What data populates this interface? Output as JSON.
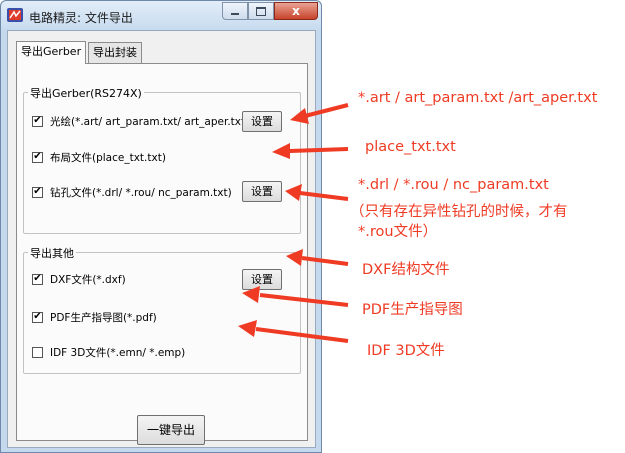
{
  "window": {
    "title": "电路精灵: 文件导出",
    "close_glyph": "x"
  },
  "tabs": [
    {
      "label": "导出Gerber",
      "active": true
    },
    {
      "label": "导出封装",
      "active": false
    }
  ],
  "gerber_group": {
    "title": "导出Gerber(RS274X)",
    "items": [
      {
        "label": "光绘(*.art/ art_param.txt/ art_aper.txt)",
        "checked": true,
        "has_settings": true
      },
      {
        "label": "布局文件(place_txt.txt)",
        "checked": true,
        "has_settings": false
      },
      {
        "label": "钻孔文件(*.drl/ *.rou/ nc_param.txt)",
        "checked": true,
        "has_settings": true
      }
    ]
  },
  "other_group": {
    "title": "导出其他",
    "items": [
      {
        "label": "DXF文件(*.dxf)",
        "checked": true,
        "has_settings": true
      },
      {
        "label": "PDF生产指导图(*.pdf)",
        "checked": true,
        "has_settings": false
      },
      {
        "label": "IDF 3D文件(*.emn/ *.emp)",
        "checked": false,
        "has_settings": false
      }
    ]
  },
  "settings_label": "设置",
  "check_mark": "✔",
  "export_button": "一键导出",
  "annotations": [
    "*.art / art_param.txt /art_aper.txt",
    "place_txt.txt",
    "*.drl / *.rou / nc_param.txt",
    "（只有存在异性钻孔的时候，才有",
    "*.rou文件）",
    "DXF结构文件",
    "PDF生产指导图",
    "IDF 3D文件"
  ],
  "colors": {
    "annotation": "#ef3b24",
    "window_frame": "#c5d9ee",
    "close_button": "#c7432a"
  }
}
